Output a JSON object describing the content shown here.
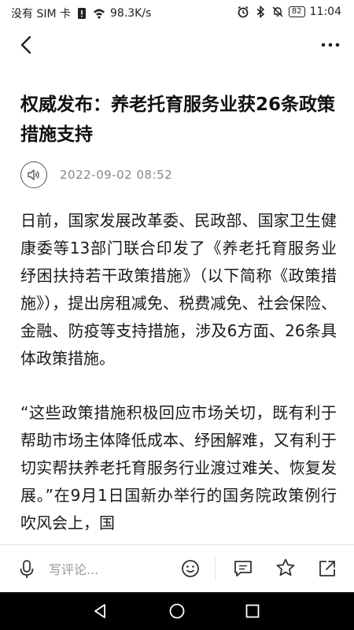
{
  "status_bar": {
    "carrier": "没有 SIM 卡",
    "net_speed": "98.3K/s",
    "battery": "82",
    "time": "11:04"
  },
  "icons": {
    "back": "back-arrow-icon",
    "more": "more-dots-icon",
    "audio": "speaker-icon",
    "mic": "microphone-icon",
    "emoji": "emoji-icon",
    "comment": "comment-icon",
    "favorite": "star-icon",
    "share": "share-icon"
  },
  "article": {
    "title": "权威发布：养老托育服务业获26条政策措施支持",
    "date": "2022-09-02 08:52",
    "paragraphs": [
      "日前，国家发展改革委、民政部、国家卫生健康委等13部门联合印发了《养老托育服务业纾困扶持若干政策措施》（以下简称《政策措施》），提出房租减免、税费减免、社会保险、金融、防疫等支持措施，涉及6方面、26条具体政策措施。",
      "“这些政策措施积极回应市场关切，既有利于帮助市场主体降低成本、纾困解难，又有利于切实帮扶养老托育服务行业渡过难关、恢复发展。”在9月1日国新办举行的国务院政策例行吹风会上，国"
    ]
  },
  "comment_bar": {
    "placeholder": "写评论..."
  }
}
